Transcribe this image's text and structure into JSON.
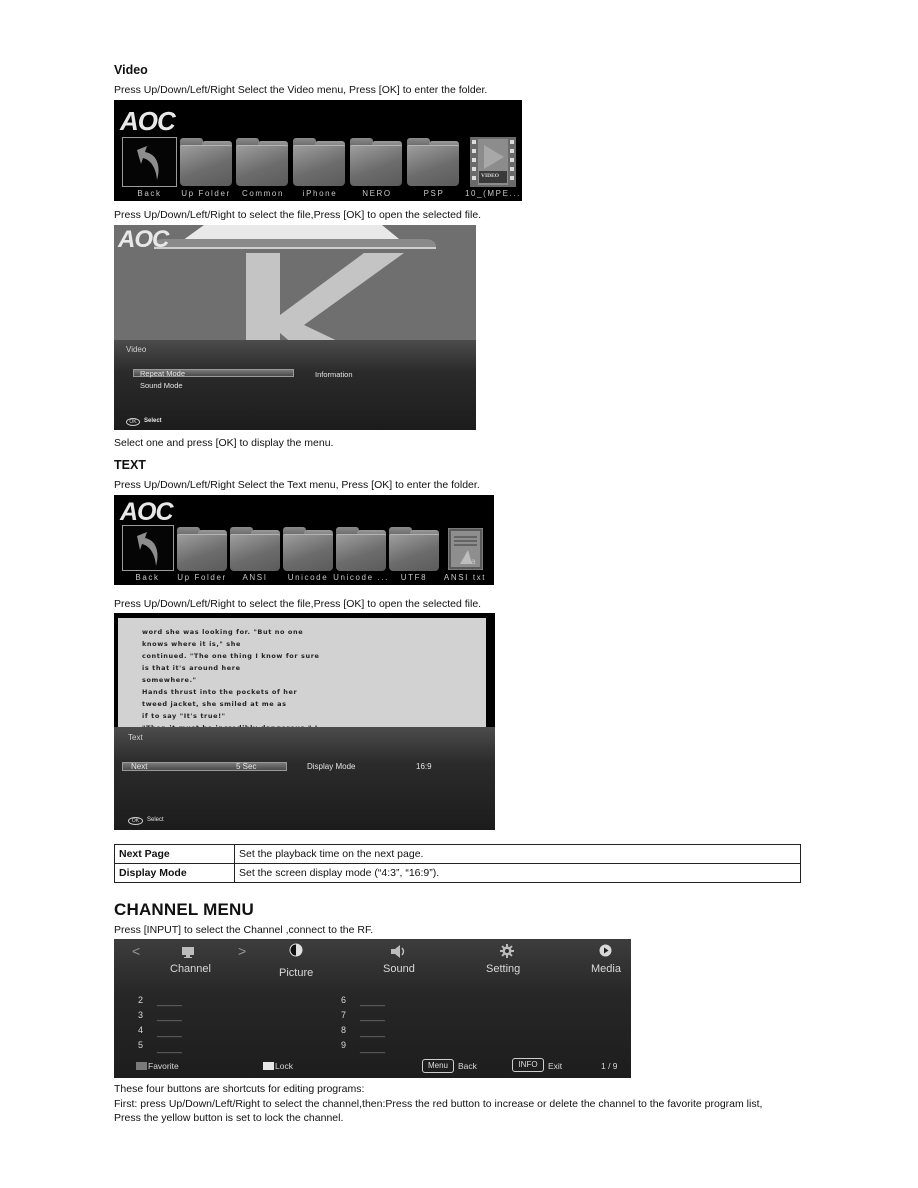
{
  "video_section": {
    "heading": "Video",
    "intro": "Press Up/Down/Left/Right Select the Video menu, Press [OK] to enter the folder.",
    "browser": {
      "logo": "AOC",
      "items": [
        {
          "label": "Back",
          "icon": "back-arrow-icon"
        },
        {
          "label": "Up Folder",
          "icon": "folder-icon"
        },
        {
          "label": "Common",
          "icon": "folder-icon"
        },
        {
          "label": "iPhone",
          "icon": "folder-icon"
        },
        {
          "label": "NERO",
          "icon": "folder-icon"
        },
        {
          "label": "PSP",
          "icon": "folder-icon"
        },
        {
          "label": "10_(MPE...",
          "icon": "video-file-icon"
        }
      ],
      "video_badge": "VIDEO"
    },
    "open_instruction": "Press Up/Down/Left/Right to select the file,Press [OK] to open the selected file.",
    "playback": {
      "logo": "AOC",
      "osd_title": "Video",
      "menu_items": [
        "Repeat Mode",
        "Sound Mode"
      ],
      "info_label": "Information",
      "footer_ok": "OK",
      "footer_select": "Select"
    },
    "after_note": "Select one and press [OK] to display the menu."
  },
  "text_section": {
    "heading": "TEXT",
    "intro": "Press Up/Down/Left/Right Select the Text menu, Press [OK] to enter the folder.",
    "browser": {
      "logo": "AOC",
      "items": [
        {
          "label": "Back",
          "icon": "back-arrow-icon"
        },
        {
          "label": "Up Folder",
          "icon": "folder-icon"
        },
        {
          "label": "ANSI",
          "icon": "folder-icon"
        },
        {
          "label": "Unicode",
          "icon": "folder-icon"
        },
        {
          "label": "Unicode ...",
          "icon": "folder-icon"
        },
        {
          "label": "UTF8",
          "icon": "folder-icon"
        },
        {
          "label": "ANSI txt",
          "icon": "text-file-icon"
        }
      ]
    },
    "open_instruction": "Press Up/Down/Left/Right to select the file,Press [OK] to open the selected file.",
    "reader": {
      "lines": [
        "word she was looking for. \"But no one",
        "knows where it is,\" she",
        "continued. \"The one thing I know for sure",
        "is that it's around here",
        "somewhere.\"",
        "Hands thrust into the pockets of her",
        "tweed jacket, she smiled at me as",
        "if to say \"It's true!\"",
        "\"Then it must be incredibly dangerous,\" I"
      ],
      "osd_title": "Text",
      "next_label": "Next",
      "next_value": "5 Sec",
      "display_mode_label": "Display Mode",
      "display_mode_value": "16:9",
      "footer_ok": "OK",
      "footer_select": "Select"
    },
    "table": [
      {
        "key": "Next Page",
        "desc": "Set the playback time on the next page."
      },
      {
        "key": "Display Mode",
        "desc": "Set the screen display mode (“4:3”, “16:9”)."
      }
    ]
  },
  "channel_section": {
    "heading": "CHANNEL MENU",
    "intro": "Press [INPUT] to select the Channel ,connect to the RF.",
    "menu": {
      "tabs": [
        {
          "label": "Channel",
          "icon": "tv-icon"
        },
        {
          "label": "Picture",
          "icon": "contrast-icon"
        },
        {
          "label": "Sound",
          "icon": "speaker-icon"
        },
        {
          "label": "Setting",
          "icon": "gear-icon"
        },
        {
          "label": "Media",
          "icon": "play-icon"
        }
      ],
      "channels_left": [
        {
          "num": "2",
          "name": "_____"
        },
        {
          "num": "3",
          "name": "_____"
        },
        {
          "num": "4",
          "name": "_____"
        },
        {
          "num": "5",
          "name": "_____"
        }
      ],
      "channels_right": [
        {
          "num": "6",
          "name": "_____"
        },
        {
          "num": "7",
          "name": "_____"
        },
        {
          "num": "8",
          "name": "_____"
        },
        {
          "num": "9",
          "name": "_____"
        }
      ],
      "footer": {
        "favorite": "Favorite",
        "lock": "Lock",
        "menu_key": "Menu",
        "back": "Back",
        "info_key": "INFO",
        "exit": "Exit",
        "page": "1 / 9"
      },
      "colors": {
        "favorite": "#7a7a7a",
        "lock": "#e6e6e6"
      }
    },
    "notes": [
      "These four buttons are shortcuts for editing programs:",
      "First:  press Up/Down/Left/Right to select the channel,then:Press the red button to increase or delete the channel to the favorite program list,",
      "Press the yellow button is set to lock the channel."
    ]
  }
}
